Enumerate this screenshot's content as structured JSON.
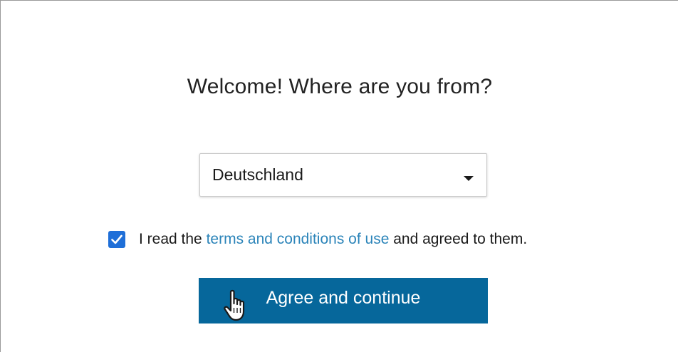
{
  "header": {
    "title": "Welcome! Where are you from?"
  },
  "country_select": {
    "selected": "Deutschland",
    "icon": "caret-down-icon"
  },
  "consent": {
    "checked": true,
    "text_before": "I read the ",
    "link_text": "terms and conditions of use",
    "text_after": " and agreed to them.",
    "checkbox_color": "#1f6fd8",
    "link_color": "#2b84b9"
  },
  "actions": {
    "continue_label": "Agree and continue",
    "button_color": "#06679b",
    "cursor_icon": "hand-pointer-icon"
  }
}
